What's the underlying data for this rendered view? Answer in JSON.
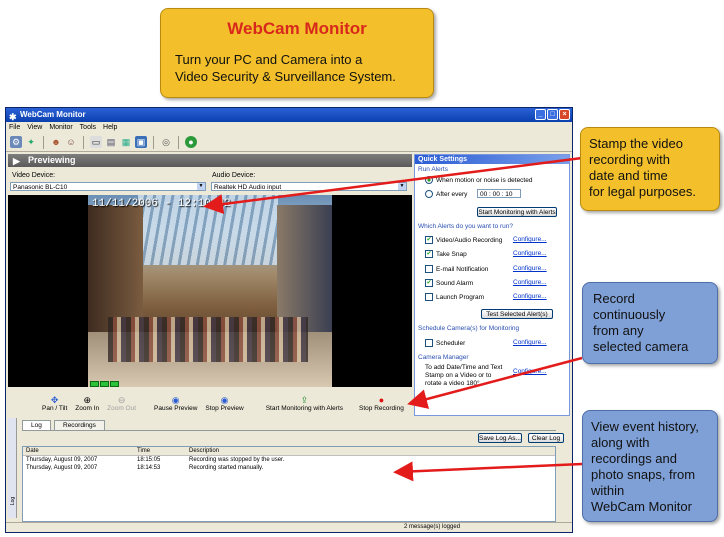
{
  "hero": {
    "title": "WebCam Monitor",
    "subtitle_line1": "Turn your PC and Camera into a",
    "subtitle_line2": "Video Security & Surveillance System."
  },
  "callouts": {
    "stamp": [
      "Stamp the video",
      "recording with",
      "date and time",
      "for legal purposes."
    ],
    "record": [
      "Record",
      "continuously",
      "from any",
      "selected camera"
    ],
    "history": [
      "View event history,",
      "along with",
      "recordings and",
      "photo snaps, from",
      "within",
      "WebCam Monitor"
    ]
  },
  "window": {
    "title": "WebCam Monitor",
    "menu": [
      "File",
      "View",
      "Monitor",
      "Tools",
      "Help"
    ]
  },
  "preview": {
    "header": "Previewing",
    "video_device_label": "Video Device:",
    "video_device_value": "Panasonic BL-C10",
    "audio_device_label": "Audio Device:",
    "audio_device_value": "Realtek HD Audio input",
    "timestamp": "11/11/2006 - 12:10:02"
  },
  "controls": {
    "pan_tilt": "Pan / Tilt",
    "zoom_in": "Zoom In",
    "zoom_out": "Zoom Out",
    "pause_preview": "Pause Preview",
    "stop_preview": "Stop Preview",
    "start_monitoring": "Start Monitoring with Alerts",
    "stop_recording": "Stop Recording"
  },
  "quick_settings": {
    "title": "Quick Settings",
    "run_alerts": "Run Alerts",
    "when_motion": "When motion or noise is detected",
    "after_every": "After every",
    "interval": "00 : 00 : 10",
    "start_btn": "Start Monitoring with Alerts",
    "which_alerts": "Which Alerts do you want to run?",
    "alerts": [
      {
        "label": "Video/Audio Recording",
        "checked": true,
        "link": "Configure..."
      },
      {
        "label": "Take Snap",
        "checked": true,
        "link": "Configure..."
      },
      {
        "label": "E-mail Notification",
        "checked": false,
        "link": "Configure..."
      },
      {
        "label": "Sound Alarm",
        "checked": true,
        "link": "Configure..."
      },
      {
        "label": "Launch Program",
        "checked": false,
        "link": "Configure..."
      }
    ],
    "test_btn": "Test Selected Alert(s)",
    "schedule_title": "Schedule Camera(s) for Monitoring",
    "scheduler": "Scheduler",
    "scheduler_link": "Configure...",
    "camera_manager": "Camera Manager",
    "cm_text1": "To add Date/Time and Text",
    "cm_text2": "Stamp on a Video or to",
    "cm_text3": "rotate a video 180°",
    "cm_link": "Configure..."
  },
  "log": {
    "tabs": [
      "Log",
      "Recordings"
    ],
    "save_btn": "Save Log As...",
    "clear_btn": "Clear Log",
    "columns": [
      "Date",
      "Time",
      "Description"
    ],
    "rows": [
      [
        "Thursday, August 09, 2007",
        "18:15:05",
        "Recording was stopped by the user."
      ],
      [
        "Thursday, August 09, 2007",
        "18:14:53",
        "Recording started manually."
      ]
    ],
    "side_label": "Log",
    "status": "2 message(s) logged"
  },
  "colors": {
    "callout_yellow": "#f3c02b",
    "callout_blue": "#7fa0d6",
    "title_red": "#d8281c",
    "arrow_red": "#e31b1b"
  }
}
